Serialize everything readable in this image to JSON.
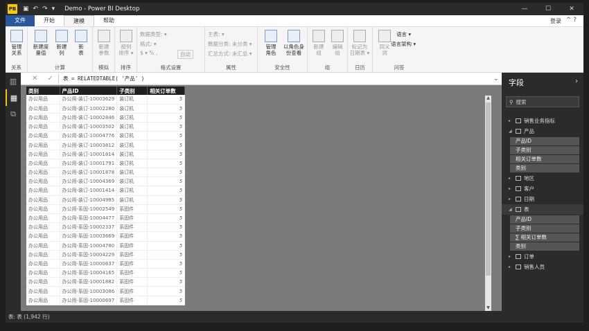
{
  "window": {
    "title": "Demo - Power BI Desktop",
    "app_icon": "PB",
    "controls": [
      "—",
      "☐",
      "✕"
    ]
  },
  "tabs": [
    {
      "label": "文件"
    },
    {
      "label": "开始"
    },
    {
      "label": "建模"
    },
    {
      "label": "帮助"
    }
  ],
  "login": "登录",
  "ribbon": {
    "groups": {
      "relations": "关系",
      "calc": "计算",
      "what_if": "模拟",
      "sort": "排序",
      "format": "格式设置",
      "props": "属性",
      "security": "安全性",
      "group": "组",
      "calendar": "日历",
      "qa": "问答"
    },
    "buttons": {
      "manage_rel": "管理\n关系",
      "new_measure": "新建度\n量值",
      "new_col": "新建\n列",
      "new_table": "新\n表",
      "new_param": "新建\n参数",
      "sort_by": "按列\n排序 ▾",
      "manage_roles": "管理\n角色",
      "view_as": "以角色身\n份查看",
      "new_group": "新建\n组",
      "edit_group": "编辑\n组",
      "mark_date": "标记为\n日期表 ▾",
      "synonyms": "同义\n词"
    },
    "format_rows": {
      "data_type": "数据类型: ▾",
      "format": "格式: ▾",
      "currency": "$ ▾  %  ,",
      "auto": "自动"
    },
    "prop_rows": {
      "home_table": "主表: ▾",
      "data_category": "数据分类: 未分类 ▾",
      "summarize": "汇总方式: 未汇总 ▾"
    },
    "qa_rows": {
      "language": "语言 ▾",
      "schema": "语言架构 ▾"
    }
  },
  "formula": "表 = RELATEDTABLE( '产品' )",
  "grid": {
    "headers": [
      "类别",
      "产品ID",
      "子类别",
      "相关订单数"
    ],
    "rows": [
      [
        "办公用品",
        "办公用-装订-10003629",
        "装订机",
        "5"
      ],
      [
        "办公用品",
        "办公用-装订-10002280",
        "装订机",
        "5"
      ],
      [
        "办公用品",
        "办公用-装订-10002846",
        "装订机",
        "5"
      ],
      [
        "办公用品",
        "办公用-装订-10003502",
        "装订机",
        "5"
      ],
      [
        "办公用品",
        "办公用-装订-10004776",
        "装订机",
        "5"
      ],
      [
        "办公用品",
        "办公用-装订-10003812",
        "装订机",
        "5"
      ],
      [
        "办公用品",
        "办公用-装订-10001814",
        "装订机",
        "5"
      ],
      [
        "办公用品",
        "办公用-装订-10001791",
        "装订机",
        "5"
      ],
      [
        "办公用品",
        "办公用-装订-10001878",
        "装订机",
        "5"
      ],
      [
        "办公用品",
        "办公用-装订-10004369",
        "装订机",
        "5"
      ],
      [
        "办公用品",
        "办公用-装订-10001414",
        "装订机",
        "5"
      ],
      [
        "办公用品",
        "办公用-装订-10004985",
        "装订机",
        "5"
      ],
      [
        "办公用品",
        "办公用-系固-10002549",
        "系固件",
        "5"
      ],
      [
        "办公用品",
        "办公用-系固-10004477",
        "系固件",
        "5"
      ],
      [
        "办公用品",
        "办公用-系固-10002337",
        "系固件",
        "5"
      ],
      [
        "办公用品",
        "办公用-系固-10003669",
        "系固件",
        "5"
      ],
      [
        "办公用品",
        "办公用-系固-10004780",
        "系固件",
        "5"
      ],
      [
        "办公用品",
        "办公用-系固-10004229",
        "系固件",
        "5"
      ],
      [
        "办公用品",
        "办公用-系固-10000637",
        "系固件",
        "5"
      ],
      [
        "办公用品",
        "办公用-系固-10004165",
        "系固件",
        "5"
      ],
      [
        "办公用品",
        "办公用-系固-10001882",
        "系固件",
        "5"
      ],
      [
        "办公用品",
        "办公用-系固-10003086",
        "系固件",
        "5"
      ],
      [
        "办公用品",
        "办公用-系固-10000697",
        "系固件",
        "5"
      ]
    ]
  },
  "fields": {
    "title": "字段",
    "search_placeholder": "搜索",
    "tree": [
      {
        "type": "table",
        "label": "销售业务指标",
        "icon": "calculator-icon",
        "expanded": false
      },
      {
        "type": "table",
        "label": "产品",
        "expanded": true,
        "fields": [
          "产品ID",
          "子类别",
          "相关订单数",
          "类别"
        ]
      },
      {
        "type": "table",
        "label": "地区",
        "expanded": false
      },
      {
        "type": "table",
        "label": "客户",
        "expanded": false
      },
      {
        "type": "table",
        "label": "日期",
        "expanded": false
      },
      {
        "type": "table",
        "label": "表",
        "expanded": true,
        "fields": [
          "产品ID",
          "子类别",
          "∑ 相关订单数",
          "类别"
        ]
      },
      {
        "type": "table",
        "label": "订单",
        "expanded": false
      },
      {
        "type": "table",
        "label": "销售人员",
        "expanded": false
      }
    ]
  },
  "status": "表: 表 (1,942 行)",
  "colors": {
    "accent": "#f2c811",
    "file_tab": "#2b579a",
    "dark": "#2b2b2b"
  }
}
